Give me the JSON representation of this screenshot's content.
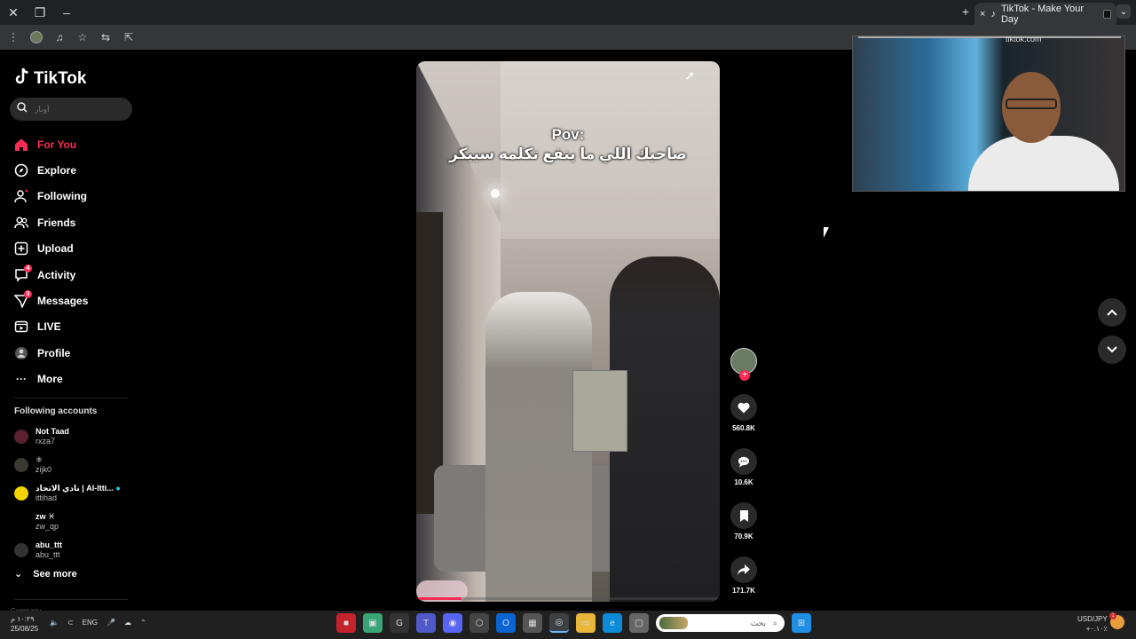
{
  "browser": {
    "tab_title": "TikTok - Make Your Day",
    "new_tab": "+",
    "close": "×",
    "menu": "⌄"
  },
  "brand": {
    "name": "TikTok",
    "accent": "#fe2c55"
  },
  "search": {
    "placeholder": "أوبار"
  },
  "nav": [
    {
      "label": "For You",
      "icon": "home-icon",
      "active": true
    },
    {
      "label": "Explore",
      "icon": "compass-icon"
    },
    {
      "label": "Following",
      "icon": "following-icon"
    },
    {
      "label": "Friends",
      "icon": "friends-icon"
    },
    {
      "label": "Upload",
      "icon": "upload-icon"
    },
    {
      "label": "Activity",
      "icon": "activity-icon",
      "badge": "4"
    },
    {
      "label": "Messages",
      "icon": "messages-icon",
      "badge": "3"
    },
    {
      "label": "LIVE",
      "icon": "live-icon"
    },
    {
      "label": "Profile",
      "icon": "profile-icon"
    },
    {
      "label": "More",
      "icon": "more-icon"
    }
  ],
  "following": {
    "title": "Following accounts",
    "accounts": [
      {
        "name": "Not Taad",
        "handle": "rxza7"
      },
      {
        "name": "⚛",
        "handle": "zijk0"
      },
      {
        "name": "نادي الاتحاد | Al-Itti...",
        "handle": "ittihad"
      },
      {
        "name": "zw ♓",
        "handle": "zw_qp"
      },
      {
        "name": "abu_ttt",
        "handle": "abu_ttt"
      }
    ],
    "see_more": "See more",
    "company": "Company"
  },
  "video": {
    "caption_line1": "Pov:",
    "caption_line2": "صاحبك اللي ما ينفع تكلمه سبيكر",
    "progress": 0.15
  },
  "actions": {
    "likes": "560.8K",
    "comments": "10.6K",
    "saves": "70.9K",
    "shares": "171.7K"
  },
  "webcam": {
    "url_text": "tiktok.com"
  },
  "taskbar": {
    "time": "١٠:٢٩ م",
    "date": "25/08/25",
    "language": "ENG",
    "search_placeholder": "بحث",
    "currency_pair": "USD/JPY",
    "currency_value": "+٠.١٠٪",
    "badge": "1"
  }
}
